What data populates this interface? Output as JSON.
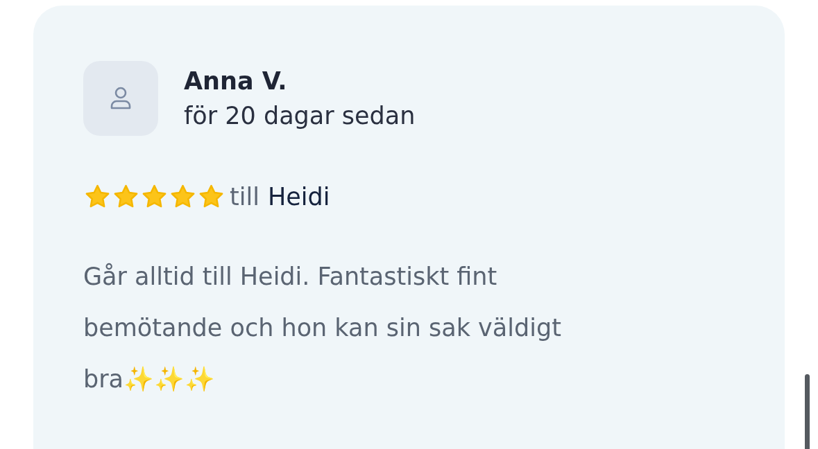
{
  "review": {
    "author": "Anna V.",
    "time": "för 20 dagar sedan",
    "stars": 5,
    "to_label": "till",
    "to_name": "Heidi",
    "text": "Går alltid till Heidi. Fantastiskt fint bemötande och hon kan sin sak väldigt bra✨✨✨"
  }
}
